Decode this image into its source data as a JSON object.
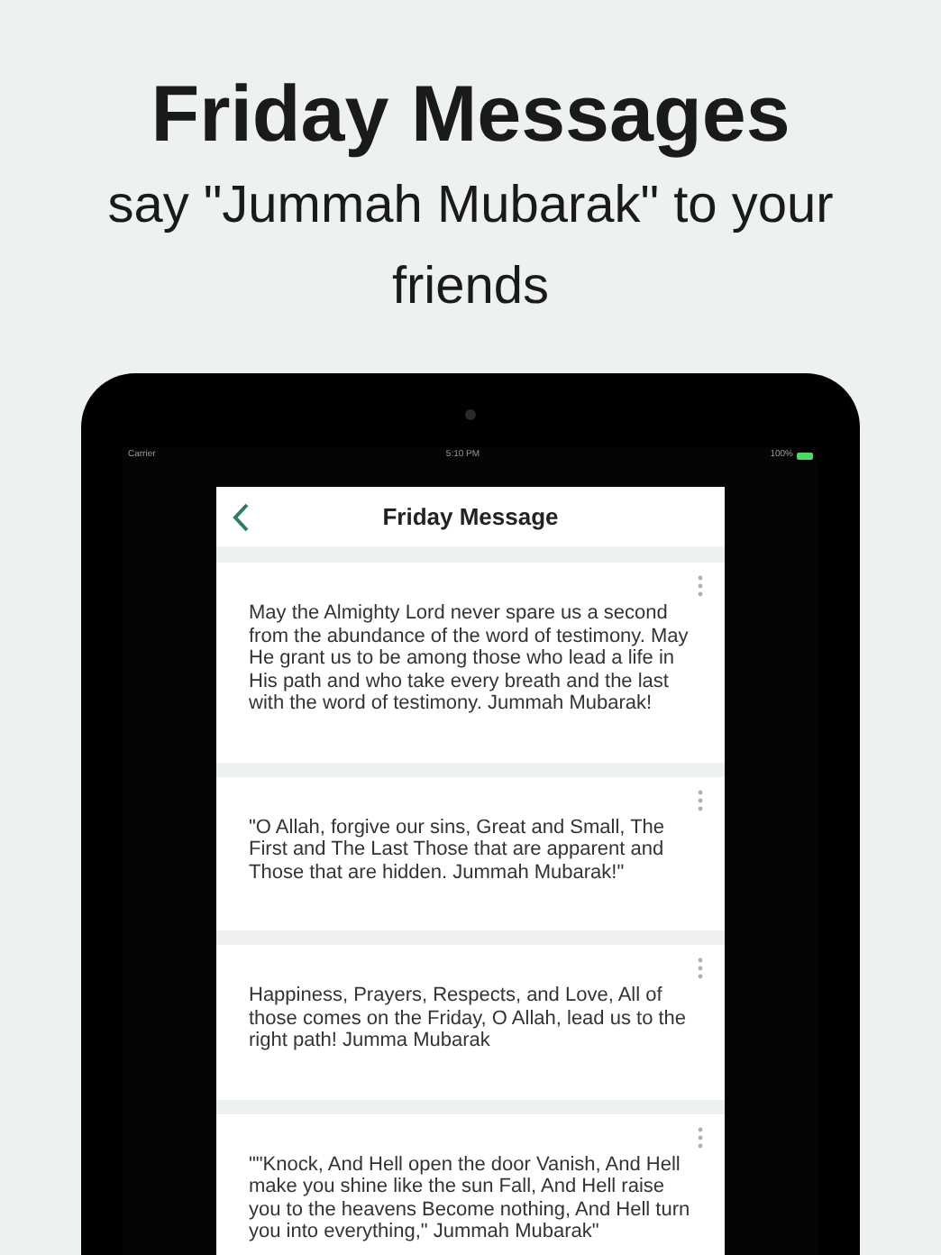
{
  "promo": {
    "title": "Friday Messages",
    "subtitle": "say \"Jummah Mubarak\" to your friends"
  },
  "status_bar": {
    "carrier": "Carrier",
    "time": "5:10 PM",
    "battery": "100%"
  },
  "nav_bar": {
    "title": "Friday Message"
  },
  "messages": [
    {
      "text": "May the Almighty Lord never spare us a second from the abundance of the word of testimony. May He grant us to be among those who lead a life in His path and who take every breath and the last with the word of testimony. Jummah Mubarak!"
    },
    {
      "text": "\"O Allah, forgive our sins, Great and Small, The First and The Last Those that are apparent and Those that are hidden. Jummah Mubarak!\""
    },
    {
      "text": "Happiness, Prayers, Respects, and Love, All of those comes on the Friday, O Allah, lead us to the right path! Jumma Mubarak"
    },
    {
      "text": "\"\"Knock, And Hell open the door Vanish, And Hell make you shine like the sun Fall, And Hell raise you to the heavens Become nothing, And Hell turn you into everything,\" Jummah Mubarak\""
    }
  ]
}
